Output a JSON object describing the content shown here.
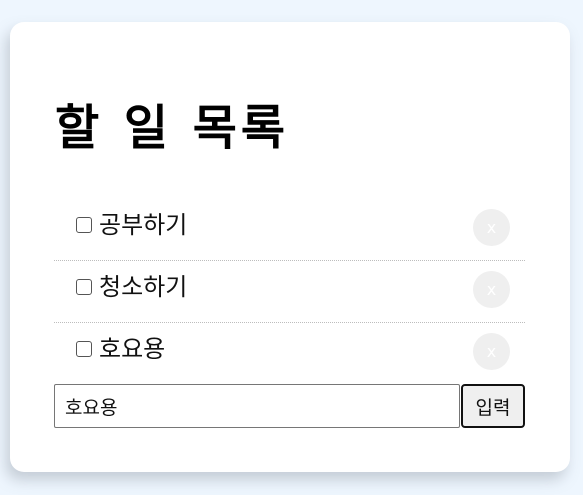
{
  "title": "할 일 목록",
  "todos": [
    {
      "label": "공부하기",
      "checked": false,
      "delete_label": "x"
    },
    {
      "label": "청소하기",
      "checked": false,
      "delete_label": "x"
    },
    {
      "label": "호요용",
      "checked": false,
      "delete_label": "x"
    }
  ],
  "input": {
    "value": "호요용",
    "placeholder": ""
  },
  "submit_label": "입력",
  "colors": {
    "page_background": "#eef6fe",
    "card_background": "#ffffff",
    "delete_button_background": "#efefef",
    "submit_button_background": "#efefef"
  }
}
